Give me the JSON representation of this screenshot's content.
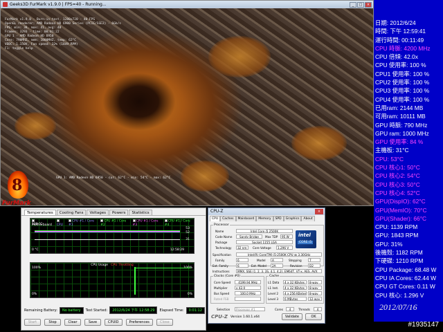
{
  "furmark": {
    "title": "Geeks3D FurMark v1.9.0 | FPS=40 - Running...",
    "info_lines": [
      "FurMark v1.9.0 - Burn-in test, 1280x720 - 40 FPS",
      "OpenGL renderer: AMD Radeon HD 6900 Series (PCIE/SSE2) - 6Gb/s",
      "FPS: min: 38, max: 41, avg: 40",
      "Frames: 3293 - time: 00:01:22",
      "GPU 1 - AMD Radeon HD 6950",
      "  Core: 790MHZ, mem: 1000MHZ, temp: 62°C",
      "  VDDC: 1.150V, Fan speed: 32% (1849 RPM)",
      "F1: toggle help"
    ],
    "temp_overlay": "GPU 1: AMD Radeon HD 6950 - cur: 62°C - min: 54°C - max: 62°C",
    "logo_number": "8",
    "logo_word": "FurMark"
  },
  "osd": {
    "rows": [
      {
        "text": "日期: 2012/6/24",
        "color": "w"
      },
      {
        "text": "時間: 下午 12:59:41",
        "color": "w"
      },
      {
        "text": "運行時間: 00:11:49",
        "color": "w"
      },
      {
        "text": "CPU 時脈: 4200 MHz",
        "color": "m"
      },
      {
        "text": "CPU 倍頻: 42.0x",
        "color": "w"
      },
      {
        "text": "CPU 使用率: 100 %",
        "color": "w"
      },
      {
        "text": "CPU1 使用率: 100 %",
        "color": "w"
      },
      {
        "text": "CPU2 使用率: 100 %",
        "color": "w"
      },
      {
        "text": "CPU3 使用率: 100 %",
        "color": "w"
      },
      {
        "text": "CPU4 使用率: 100 %",
        "color": "w"
      },
      {
        "text": "已用ram: 2144 MB",
        "color": "w"
      },
      {
        "text": "可用ram: 10111 MB",
        "color": "w"
      },
      {
        "text": "GPU 時脈: 790 MHz",
        "color": "w"
      },
      {
        "text": "GPU ram: 1000 MHz",
        "color": "w"
      },
      {
        "text": "GPU 使用率: 84 %",
        "color": "m"
      },
      {
        "text": "主機板: 31°C",
        "color": "w"
      },
      {
        "text": "CPU: 53°C",
        "color": "m"
      },
      {
        "text": "CPU 核心1: 50°C",
        "color": "m"
      },
      {
        "text": "CPU 核心2: 54°C",
        "color": "m"
      },
      {
        "text": "CPU 核心3: 50°C",
        "color": "m"
      },
      {
        "text": "CPU 核心4: 52°C",
        "color": "m"
      },
      {
        "text": "GPU(DispIO): 62°C",
        "color": "m"
      },
      {
        "text": "GPU(MemIO): 70°C",
        "color": "m"
      },
      {
        "text": "GPU(Shader): 66°C",
        "color": "m"
      },
      {
        "text": "CPU: 1139 RPM",
        "color": "w"
      },
      {
        "text": "GPU: 1843 RPM",
        "color": "w"
      },
      {
        "text": "GPU: 31%",
        "color": "w"
      },
      {
        "text": "後機殼: 1182 RPM",
        "color": "w"
      },
      {
        "text": "下硬碟: 1210 RPM",
        "color": "w"
      },
      {
        "text": "CPU Package: 68.48 W",
        "color": "w"
      },
      {
        "text": "CPU IA Cores: 62.44 W",
        "color": "w"
      },
      {
        "text": "CPU GT Cores: 0.11 W",
        "color": "w"
      },
      {
        "text": "CPU 核心: 1.296 V",
        "color": "w"
      }
    ],
    "photo_date": "2012/07/16",
    "watermark": "#1935147"
  },
  "tempwin": {
    "tabs": [
      "Temperatures",
      "Cooling Fans",
      "Voltages",
      "Powers",
      "Statistics"
    ],
    "active_tab": 0,
    "legend": [
      {
        "label": "Motherboard",
        "cls": "mb"
      },
      {
        "label": "CPU",
        "cls": "c"
      },
      {
        "label": "CPU #1 / Core #1",
        "cls": "c"
      },
      {
        "label": "CPU #1 / Core #2",
        "cls": "g"
      },
      {
        "label": "CPU #1 / Core #3",
        "cls": "cc"
      },
      {
        "label": "CPU #1 / Core #4",
        "cls": "g"
      }
    ],
    "temp_ymax": "100 °C",
    "temp_ymin": "0 °C",
    "temp_values": [
      "53",
      "52",
      "31"
    ],
    "temp_time": "12:58:29",
    "usage_title": "CPU Usage",
    "throttle_title": "CPU Throttling",
    "usage_ymax": "100%",
    "usage_ymin": "0%",
    "usage_rmax": "100%",
    "usage_rmin": "0%",
    "remaining_label": "Remaining Battery:",
    "remaining_value": "No battery",
    "test_started_label": "Test Started:",
    "test_started_value": "2012/6/24 下午 12:58:29",
    "elapsed_label": "Elapsed Time:",
    "elapsed_value": "0:01:12",
    "buttons": [
      {
        "label": "Start",
        "dis": true
      },
      {
        "label": "Stop",
        "dis": false
      },
      {
        "label": "Clear",
        "dis": false
      },
      {
        "label": "Save",
        "dis": false
      },
      {
        "label": "CPUID",
        "dis": false
      },
      {
        "label": "Preferences",
        "dis": false
      },
      {
        "label": "Close",
        "dis": true
      }
    ]
  },
  "cpuz": {
    "title": "CPU-Z",
    "tabs": [
      "CPU",
      "Caches",
      "Mainboard",
      "Memory",
      "SPD",
      "Graphics",
      "About"
    ],
    "processor_legend": "Processor",
    "name_label": "Name",
    "name_value": "Intel Core i5 2500K",
    "codename_label": "Code Name",
    "codename_value": "Sandy Bridge",
    "maxtdp_label": "Max TDP",
    "maxtdp_value": "95 W",
    "package_label": "Package",
    "package_value": "Socket 1155 LGA",
    "technology_label": "Technology",
    "technology_value": "32 nm",
    "corevoltage_label": "Core Voltage",
    "corevoltage_value": "1.296 V",
    "spec_label": "Specification",
    "spec_value": "Intel(R) Core(TM) i5-2500K CPU @ 3.30GHz",
    "family_label": "Family",
    "family_value": "6",
    "model_label": "Model",
    "model_value": "A",
    "stepping_label": "Stepping",
    "stepping_value": "7",
    "extfamily_label": "Ext. Family",
    "extfamily_value": "6",
    "extmodel_label": "Ext. Model",
    "extmodel_value": "2A",
    "revision_label": "Revision",
    "revision_value": "D2",
    "instr_label": "Instructions",
    "instr_value": "MMX, SSE (1, 2, 3, 3S, 4.1, 4.2), EM64T, VT-x, AES, AVX",
    "clocks_legend": "Clocks (Core #0)",
    "corespeed_label": "Core Speed",
    "corespeed_value": "4199.94 MHz",
    "multiplier_label": "Multiplier",
    "multiplier_value": "x 42.0",
    "busspeed_label": "Bus Speed",
    "busspeed_value": "100.0 MHz",
    "ratedfsb_label": "Rated FSB",
    "cache_legend": "Cache",
    "l1d_label": "L1 Data",
    "l1d_value": "4 x 32 KBytes",
    "l1d_way": "8-way",
    "l1i_label": "L1 Inst.",
    "l1i_value": "4 x 32 KBytes",
    "l1i_way": "8-way",
    "l2_label": "Level 2",
    "l2_value": "4 x 256 KBytes",
    "l2_way": "8-way",
    "l3_label": "Level 3",
    "l3_value": "6 MBytes",
    "l3_way": "12-way",
    "selection_label": "Selection",
    "selection_value": "Processor #1",
    "cores_label": "Cores",
    "cores_value": "4",
    "threads_label": "Threads",
    "threads_value": "4",
    "brand": "CPU-Z",
    "version": "Version 1.60.1.x64",
    "validate_label": "Validate",
    "ok_label": "OK",
    "intel_text": "intel",
    "core_text": "CORE i5"
  }
}
